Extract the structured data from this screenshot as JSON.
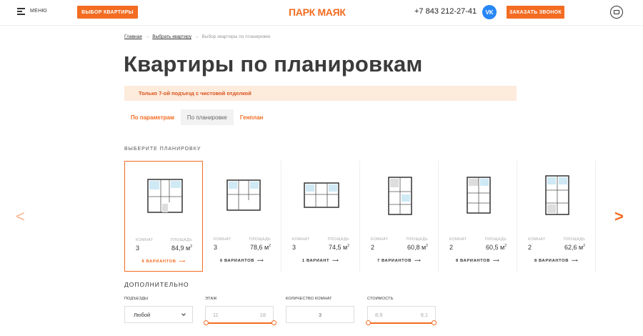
{
  "header": {
    "menu_label": "МЕНЮ",
    "choose_button": "ВЫБОР КВАРТИРЫ",
    "logo": "ПАРК МАЯК",
    "phone": "+7 843 212-27-41",
    "vk_label": "VK",
    "call_button": "ЗАКАЗАТЬ ЗВОНОК"
  },
  "breadcrumb": {
    "home": "Главная",
    "choose": "Выбрать квартиру",
    "current": "Выбор квартиры по планировке",
    "separator": "→"
  },
  "page_title": "Квартиры по планировкам",
  "notice": "Только 7-ой подъезд с чистовой отделкой",
  "tabs": [
    {
      "label": "По параметрам",
      "active": false
    },
    {
      "label": "По планировке",
      "active": true
    },
    {
      "label": "Генплан",
      "active": false
    }
  ],
  "section_label": "ВЫБЕРИТЕ ПЛАНИРОВКУ",
  "meta_labels": {
    "rooms": "КОМНАТ",
    "area": "ПЛОЩАДЬ"
  },
  "area_unit": "м",
  "cards": [
    {
      "rooms": "3",
      "area": "84,9",
      "variants": "8 ВАРИАНТОВ",
      "selected": true
    },
    {
      "rooms": "3",
      "area": "78,6",
      "variants": "6 ВАРИАНТОВ",
      "selected": false
    },
    {
      "rooms": "3",
      "area": "74,5",
      "variants": "1 ВАРИАНТ",
      "selected": false
    },
    {
      "rooms": "2",
      "area": "60,8",
      "variants": "7 ВАРИАНТОВ",
      "selected": false
    },
    {
      "rooms": "2",
      "area": "60,5",
      "variants": "8 ВАРИАНТОВ",
      "selected": false
    },
    {
      "rooms": "2",
      "area": "62,6",
      "variants": "8 ВАРИАНТОВ",
      "selected": false
    }
  ],
  "nav": {
    "prev": "<",
    "next": ">"
  },
  "filters": {
    "title": "ДОПОЛНИТЕЛЬНО",
    "district": {
      "label": "ПОДЪЕЗДЫ",
      "value": "Любой"
    },
    "floor": {
      "label": "ЭТАЖ",
      "min": "11",
      "max": "18"
    },
    "rooms": {
      "label": "КОЛИЧЕСТВО КОМНАТ",
      "value": "3"
    },
    "price": {
      "label": "СТОИМОСТЬ",
      "min": "8,9",
      "max": "9,1"
    }
  },
  "colors": {
    "accent": "#f36c21",
    "notice_bg": "#fdebdc",
    "vk": "#2787f5"
  }
}
